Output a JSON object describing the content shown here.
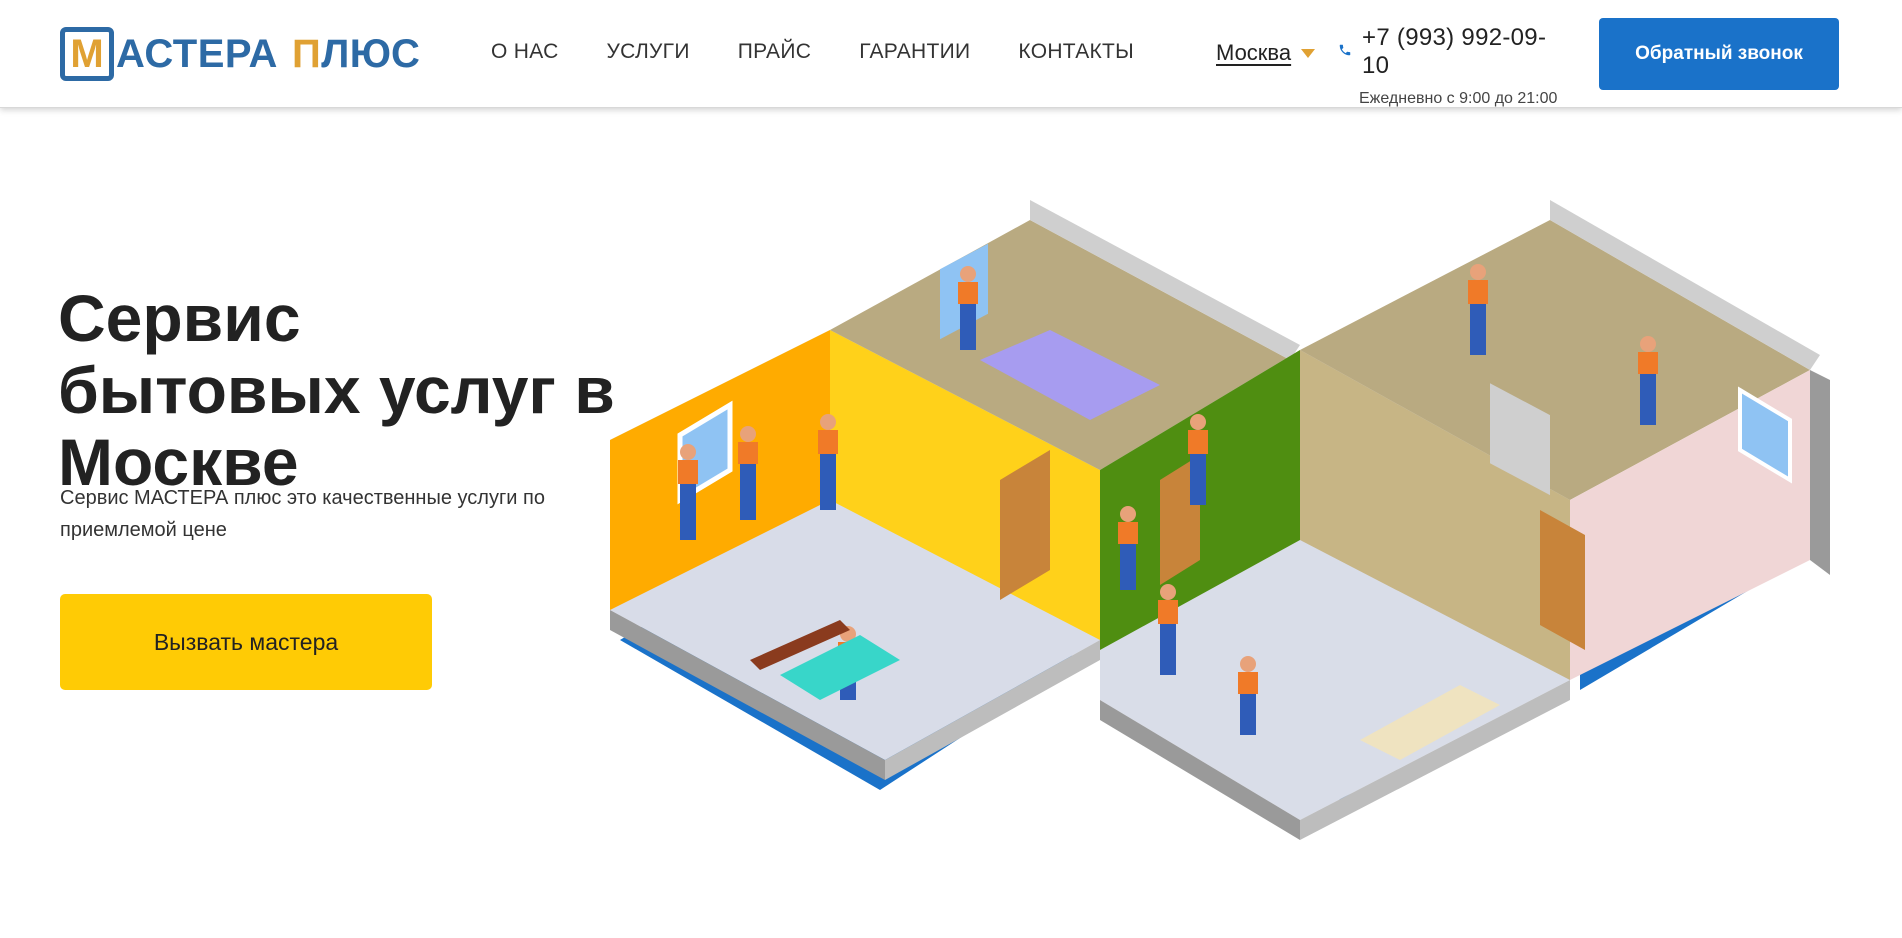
{
  "header": {
    "logo": {
      "letter": "М",
      "word1": "АСТЕРА",
      "word2": "П",
      "word3": "ЛЮС"
    },
    "nav": [
      {
        "label": "О НАС"
      },
      {
        "label": "УСЛУГИ"
      },
      {
        "label": "ПРАЙС"
      },
      {
        "label": "ГАРАНТИИ"
      },
      {
        "label": "КОНТАКТЫ"
      }
    ],
    "city": "Москва",
    "phone": "+7 (993) 992-09-10",
    "hours": "Ежедневно с 9:00 до 21:00",
    "callback_label": "Обратный звонок"
  },
  "hero": {
    "title": "Сервис бытовых услуг в Москве",
    "description": "Сервис МАСТЕРА плюс это качественные услуги по приемлемой цене",
    "cta_label": "Вызвать мастера"
  },
  "colors": {
    "brand_blue": "#1a72c9",
    "logo_blue": "#2d6aa5",
    "logo_gold": "#e0a133",
    "cta_yellow": "#ffcb05"
  },
  "icons": {
    "phone": "phone-icon",
    "caret": "chevron-down-icon"
  }
}
